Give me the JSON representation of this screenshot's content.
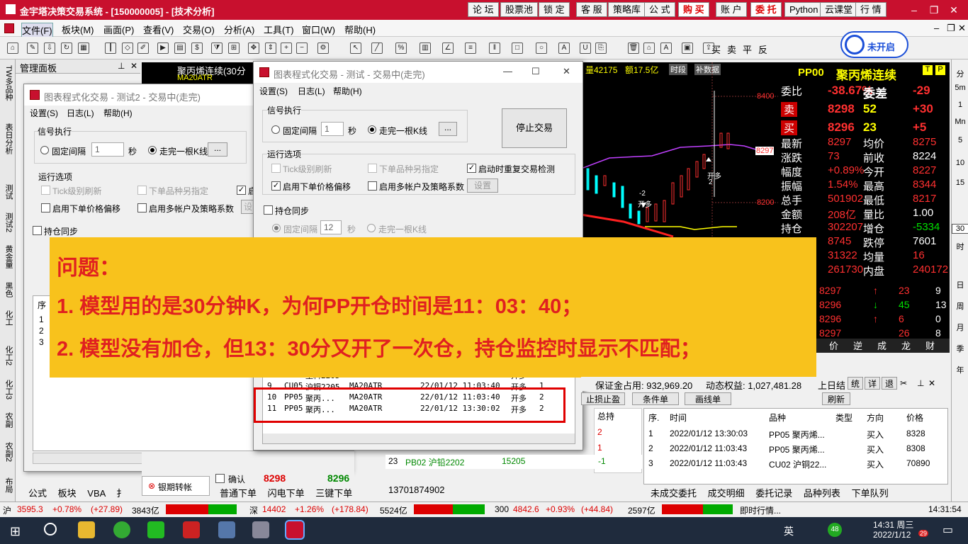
{
  "titlebar": {
    "title": "金宇塔决策交易系统 - [150000005] - [技术分析]",
    "buttons": [
      "论 坛",
      "股票池",
      "锁 定",
      "客 服",
      "策略库",
      "公 式",
      "购 买",
      "账 户",
      "委 托",
      "Python",
      "云课堂",
      "行 情"
    ]
  },
  "menu": [
    "文件(F)",
    "板块(M)",
    "画面(P)",
    "查看(V)",
    "交易(O)",
    "分析(A)",
    "工具(T)",
    "窗口(W)",
    "帮助(H)"
  ],
  "toolbar": {
    "extra": [
      "买",
      "卖",
      "平",
      "反"
    ],
    "badge": "未开启"
  },
  "left_tabs": [
    "TW多品种",
    "表日分析",
    "测试",
    "测试2",
    "黄金量",
    "黑色",
    "化工",
    "化工2",
    "化工3",
    "农副",
    "农副2",
    "布局"
  ],
  "right_tabs": [
    "分",
    "5m",
    "1",
    "Mn",
    "5",
    "10",
    "15",
    "30",
    "时",
    "日",
    "周",
    "月",
    "季",
    "年"
  ],
  "chart": {
    "header": "聚丙烯连续(30分",
    "ma": "MA20ATR",
    "vol": "量42175",
    "amt": "额17.5亿",
    "tag1": "时段",
    "tag2": "补数据",
    "prices": [
      "8400",
      "8297",
      "8200"
    ],
    "marks": [
      "开多",
      "-2",
      "开多",
      "2"
    ]
  },
  "quote": {
    "code": "PP00",
    "name": "聚丙烯连续",
    "rows": [
      [
        "委比",
        "-38.67%",
        "委差",
        "-29"
      ],
      [
        "卖",
        "8298",
        "52",
        "+30"
      ],
      [
        "买",
        "8296",
        "23",
        "+5"
      ],
      [
        "最新",
        "8297",
        "均价",
        "8275"
      ],
      [
        "涨跌",
        "73",
        "前收",
        "8224"
      ],
      [
        "幅度",
        "+0.89%",
        "今开",
        "8227"
      ],
      [
        "振幅",
        "1.54%",
        "最高",
        "8344"
      ],
      [
        "总手",
        "501902",
        "最低",
        "8217"
      ],
      [
        "金额",
        "208亿",
        "量比",
        "1.00"
      ],
      [
        "持仓",
        "302207",
        "增仓",
        "-5334"
      ],
      [
        "",
        "8745",
        "跌停",
        "7601"
      ],
      [
        "",
        "31322",
        "均量",
        "16"
      ],
      [
        "",
        "261730",
        "内盘",
        "240172"
      ]
    ],
    "ticks": [
      [
        ":31",
        "8297",
        "↑",
        "23",
        "9"
      ],
      [
        "",
        "8296",
        "↓",
        "45",
        "13"
      ],
      [
        "",
        "8296",
        "↑",
        "6",
        "0"
      ],
      [
        "",
        "8297",
        "",
        "26",
        "8"
      ]
    ],
    "tabs": [
      "势",
      "盘",
      "价",
      "逆",
      "成",
      "龙",
      "财"
    ]
  },
  "dlg1": {
    "title": "图表程式化交易 - 测试2 - 交易中(走完)",
    "menu": [
      "设置(S)",
      "日志(L)",
      "帮助(H)"
    ],
    "g1": "信号执行",
    "fixed": "固定间隔",
    "sec": "秒",
    "full": "走完一根K线",
    "interval": "1",
    "dots": "...",
    "g2": "运行选项",
    "o1": "Tick级别刷新",
    "o2": "下单品种另指定",
    "o3": "启用下单价格偏移",
    "o4": "启用多帐户及策略系数",
    "o5": "启",
    "set": "设置",
    "sync": "持仓同步",
    "col": "序",
    "rows": [
      "1",
      "2",
      "3"
    ]
  },
  "dlg2": {
    "title": "图表程式化交易 - 测试 - 交易中(走完)",
    "menu": [
      "设置(S)",
      "日志(L)",
      "帮助(H)"
    ],
    "g1": "信号执行",
    "fixed": "固定间隔",
    "interval": "1",
    "sec": "秒",
    "full": "走完一根K线",
    "dots": "...",
    "stop": "停止交易",
    "g2": "运行选项",
    "o1": "Tick级别刷新",
    "o2": "下单品种另指定",
    "o3": "启动时重复交易检测",
    "o4": "启用下单价格偏移",
    "o5": "启用多帐户及策略系数",
    "set": "设置",
    "sync": "持仓同步",
    "sync_fixed": "固定间隔",
    "sync_interval": "12",
    "sync_sec": "秒",
    "sync_full": "走完一根K线",
    "log": [
      [
        "8",
        "LU05",
        "塑料2205",
        "MA20ATR",
        "22/01/12 10:29:39",
        "开多",
        "2"
      ],
      [
        "9",
        "CU05",
        "沪铜2205",
        "MA20ATR",
        "22/01/12 11:03:40",
        "开多",
        "1"
      ],
      [
        "10",
        "PP05",
        "聚丙...",
        "MA20ATR",
        "22/01/12 11:03:40",
        "开多",
        "2"
      ],
      [
        "11",
        "PP05",
        "聚丙...",
        "MA20ATR",
        "22/01/12 13:30:02",
        "开多",
        "2"
      ]
    ]
  },
  "banner": {
    "title": "问题：",
    "line1": "1. 模型用的是30分钟K，为何PP开仓时间是11：03：40；",
    "line2": "2. 模型没有加仓，但13：30分又开了一次仓，持仓监控时显示不匹配；"
  },
  "account": {
    "margin": "保证金占用: 932,969.20",
    "equity": "动态权益: 1,027,481.28",
    "upd": "上日结",
    "btns": [
      "统",
      "详",
      "退"
    ]
  },
  "orders": {
    "btns": [
      "止损止盈",
      "条件单",
      "画线单",
      "刷新"
    ],
    "head": [
      "序.",
      "时间",
      "品种",
      "类型",
      "方向",
      "价格"
    ],
    "rows": [
      [
        "1",
        "2022/01/12 13:30:03",
        "PP05 聚丙烯...",
        "",
        "买入",
        "8328"
      ],
      [
        "2",
        "2022/01/12 11:03:43",
        "PP05 聚丙烯...",
        "",
        "买入",
        "8308"
      ],
      [
        "3",
        "2022/01/12 11:03:43",
        "CU02 沪铜22...",
        "",
        "买入",
        "70890"
      ]
    ],
    "tabs": [
      "未成交委托",
      "成交明细",
      "委托记录",
      "品种列表",
      "下单队列"
    ]
  },
  "position": {
    "head": "总持",
    "vals": [
      "2",
      "1"
    ],
    "row": [
      "23",
      "PB02 沪铅2202",
      "15205",
      "-1"
    ],
    "phone": "13701874902"
  },
  "order_panel": {
    "confirm": "确认",
    "p1": "8298",
    "p2": "8296",
    "bank": "银期转帐",
    "tabs": [
      "普通下单",
      "闪电下单",
      "三键下单"
    ]
  },
  "left_bottom_tabs": [
    "公式",
    "板块",
    "VBA",
    "扌"
  ],
  "status": {
    "sh": "沪",
    "sh_v": "3595.3",
    "sh_c": "+0.78%",
    "sh_d": "(+27.89)",
    "sh_a": "3843亿",
    "sz": "深",
    "sz_v": "14402",
    "sz_c": "+1.26%",
    "sz_d": "(+178.84)",
    "sz_a": "5524亿",
    "hs": "300",
    "hs_v": "4842.6",
    "hs_c": "+0.93%",
    "hs_d": "(+44.84)",
    "hs_a": "2597亿",
    "msg": "即时行情...",
    "time": "14:31:54"
  },
  "taskbar": {
    "time": "14:31 周三",
    "date": "2022/1/12",
    "ime": "英",
    "badge": "48",
    "notif": "29"
  }
}
